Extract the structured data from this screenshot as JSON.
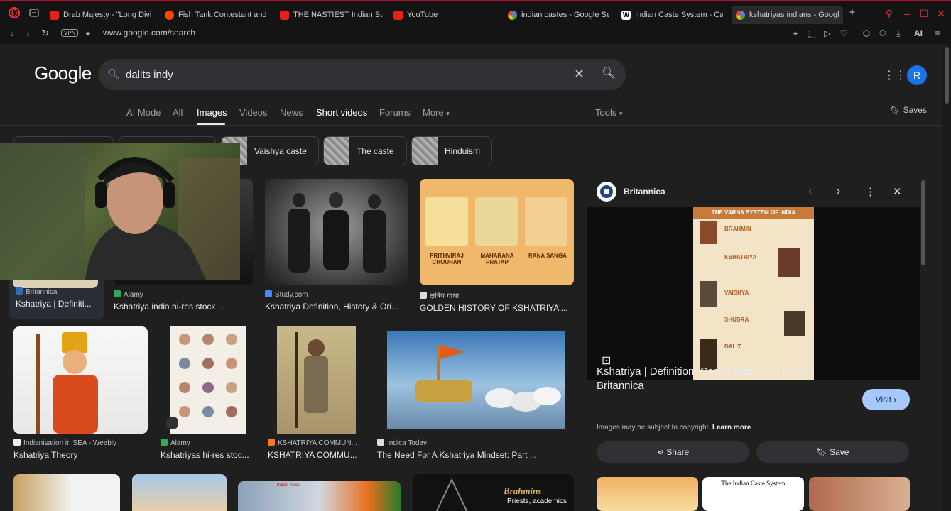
{
  "tabs": [
    {
      "label": "Drab Majesty - \"Long Divi",
      "favicon": "yt"
    },
    {
      "label": "Fish Tank Contestant and",
      "favicon": "rd"
    },
    {
      "label": "THE NASTIEST Indian Stre",
      "favicon": "yt"
    },
    {
      "label": "YouTube",
      "favicon": "yt"
    },
    {
      "label": "indian castes - Google Se",
      "favicon": "g"
    },
    {
      "label": "Indian Caste System - Ca",
      "favicon": "w"
    },
    {
      "label": "kshatriyas indians - Googl",
      "favicon": "g"
    }
  ],
  "address": {
    "vpn": "VPN",
    "url": "www.google.com/search",
    "ai": "AI"
  },
  "google": {
    "logo": "Google",
    "query": "dalits indy",
    "avatar": "R"
  },
  "filters": [
    "AI Mode",
    "All",
    "Images",
    "Videos",
    "News",
    "Short videos",
    "Forums",
    "More"
  ],
  "tools": "Tools",
  "saves": "Saves",
  "chips": [
    {
      "label": "Vaishya caste"
    },
    {
      "label": "The caste"
    },
    {
      "label": "Hinduism"
    }
  ],
  "results_row1": [
    {
      "source": "Britannica",
      "title": "Kshatriya | Definiti..."
    },
    {
      "source": "Alamy",
      "title": "Kshatriya india hi-res stock ..."
    },
    {
      "source": "Study.com",
      "title": "Kshatriya Definition, History & Ori..."
    },
    {
      "source": "क्षत्रिय गाथा",
      "title": "GOLDEN HISTORY OF KSHATRIYA'..."
    }
  ],
  "results_row2": [
    {
      "source": "Indianisation in SEA - Weebly",
      "title": "Kshatriya Theory"
    },
    {
      "source": "Alamy",
      "title": "Kshatriyas hi-res stoc..."
    },
    {
      "source": "KSHATRIYA COMMUN...",
      "title": "KSHATRIYA COMMU..."
    },
    {
      "source": "Indica Today",
      "title": "The Need For A Kshatriya Mindset: Part ..."
    }
  ],
  "golden_labels": [
    "PRITHVIRAJ CHOUHAN",
    "MAHARANA PRATAP",
    "RANA SANGA"
  ],
  "brahmins_label": {
    "title": "Brahmins",
    "sub": "Priests, academics"
  },
  "india_news_label": "Indian news",
  "panel": {
    "source": "Britannica",
    "title": "Kshatriya | Definition, Caste, History, & Facts | Britannica",
    "visit": "Visit",
    "copyright": "Images may be subject to copyright.",
    "learn_more": "Learn more",
    "share": "Share",
    "save": "Save",
    "varna_title": "THE VARNA SYSTEM OF INDIA",
    "varna": [
      "BRAHMIN",
      "KSHATRIYA",
      "VAISHYA",
      "SHUDRA",
      "DALIT"
    ],
    "related_label": "The Indian Caste System"
  },
  "colors": {
    "accent": "#a8c7fa",
    "tab_border": "#b3122a",
    "bg": "#1f1f1f"
  }
}
